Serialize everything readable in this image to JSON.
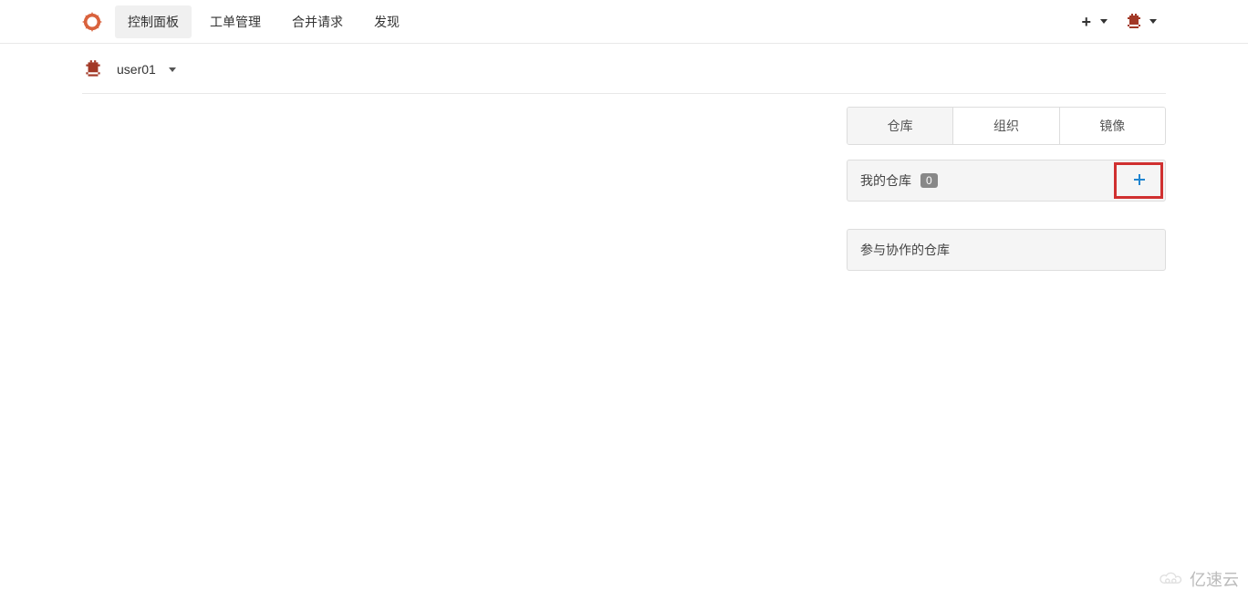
{
  "nav": {
    "items": [
      "控制面板",
      "工单管理",
      "合并请求",
      "发现"
    ],
    "active_index": 0
  },
  "user": {
    "name": "user01"
  },
  "tabs": {
    "items": [
      "仓库",
      "组织",
      "镜像"
    ],
    "active_index": 0
  },
  "panels": {
    "my_repos": {
      "title": "我的仓库",
      "count": "0"
    },
    "collab": {
      "title": "参与协作的仓库"
    }
  },
  "watermark": "亿速云",
  "colors": {
    "accent": "#2185d0",
    "highlight": "#d03030",
    "logo": "#d9623d"
  }
}
